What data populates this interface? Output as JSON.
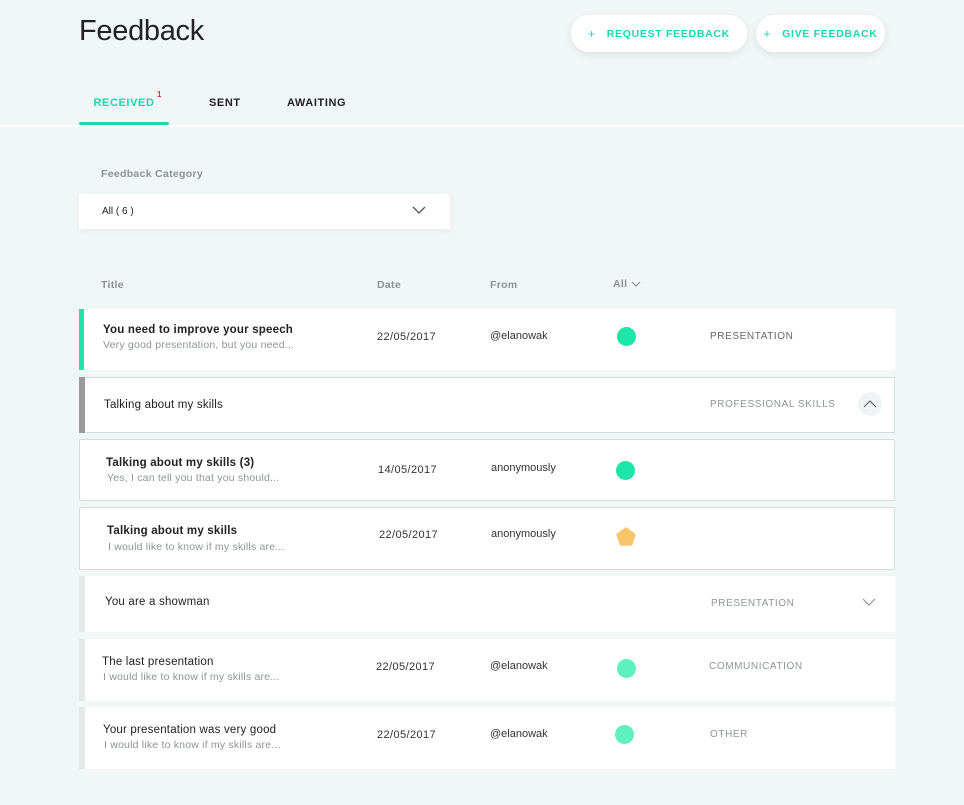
{
  "header": {
    "title": "Feedback",
    "request_button": {
      "plus": "+",
      "label": "REQUEST FEEDBACK"
    },
    "give_button": {
      "plus": "+",
      "label": "GIVE FEEDBACK"
    }
  },
  "tabs": [
    {
      "label": "RECEIVED",
      "badge": "1",
      "active": true
    },
    {
      "label": "SENT"
    },
    {
      "label": "AWAITING"
    }
  ],
  "filter": {
    "label": "Feedback Category",
    "value": "All ( 6 )"
  },
  "columns": {
    "title": "Title",
    "date": "Date",
    "from": "From",
    "all": "All"
  },
  "rows": [
    {
      "title": "You need to improve your speech",
      "subtitle": "Very good presentation, but you need...",
      "date": "22/05/2017",
      "from": "@elanowak",
      "category": "PRESENTATION",
      "status_color": "#1ee6a8",
      "accent": "#1ee6a8"
    },
    {
      "title": "Talking about my skills",
      "category": "PROFESSIONAL SKILLS",
      "accent": "#9a9a9a",
      "expanded": true
    },
    {
      "title": "Talking about my skills (3)",
      "subtitle": "Yes, I can tell you that you should...",
      "date": "14/05/2017",
      "from": "anonymously",
      "status_color": "#1ee6a8"
    },
    {
      "title": "Talking about my skills",
      "subtitle": "I would like to know if my skills are...",
      "date": "22/05/2017",
      "from": "anonymously",
      "status_color": "#f8c56b",
      "status_shape": "pentagon"
    },
    {
      "title": "You are a showman",
      "category": "PRESENTATION",
      "accent": "#e4e8e8",
      "expanded": false
    },
    {
      "title": "The last presentation",
      "subtitle": "I would like to know if my skills are...",
      "date": "22/05/2017",
      "from": "@elanowak",
      "category": "COMMUNICATION",
      "status_color": "#5ef0bf",
      "accent": "#e4e8e8"
    },
    {
      "title": "Your presentation was very good",
      "subtitle": "I would like to know if my skills are...",
      "date": "22/05/2017",
      "from": "@elanowak",
      "category": "OTHER",
      "status_color": "#5ef0bf",
      "accent": "#e4e8e8"
    }
  ],
  "icons": {
    "select_chevron": "chevron-down-icon",
    "collapse_chevron": "chevron-up-icon",
    "expand_chevron": "chevron-down-icon",
    "status": "status-dot-icon",
    "pentagon": "pentagon-icon"
  }
}
